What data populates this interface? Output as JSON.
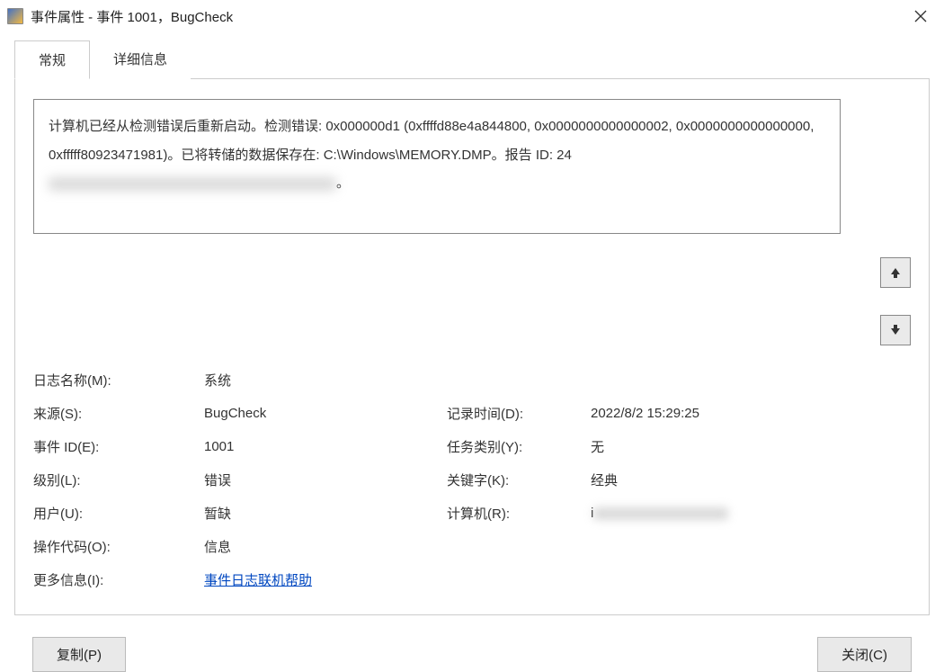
{
  "title": "事件属性 - 事件 1001，BugCheck",
  "tabs": {
    "general": "常规",
    "details": "详细信息"
  },
  "description_visible": "计算机已经从检测错误后重新启动。检测错误: 0x000000d1 (0xffffd88e4a844800, 0x0000000000000002, 0x0000000000000000, 0xfffff80923471981)。已将转储的数据保存在: C:\\Windows\\MEMORY.DMP。报告 ID: 24",
  "description_trailing": "。",
  "props": {
    "log_name": {
      "label": "日志名称(M):",
      "value": "系统"
    },
    "source": {
      "label": "来源(S):",
      "value": "BugCheck"
    },
    "logged": {
      "label": "记录时间(D):",
      "value": "2022/8/2 15:29:25"
    },
    "event_id": {
      "label": "事件 ID(E):",
      "value": "1001"
    },
    "task_cat": {
      "label": "任务类别(Y):",
      "value": "无"
    },
    "level": {
      "label": "级别(L):",
      "value": "错误"
    },
    "keywords": {
      "label": "关键字(K):",
      "value": "经典"
    },
    "user": {
      "label": "用户(U):",
      "value": "暂缺"
    },
    "computer_label": "计算机(R):",
    "computer_prefix": "i",
    "opcode": {
      "label": "操作代码(O):",
      "value": "信息"
    },
    "more_info": {
      "label": "更多信息(I):",
      "link": "事件日志联机帮助"
    }
  },
  "buttons": {
    "copy": "复制(P)",
    "close": "关闭(C)"
  }
}
